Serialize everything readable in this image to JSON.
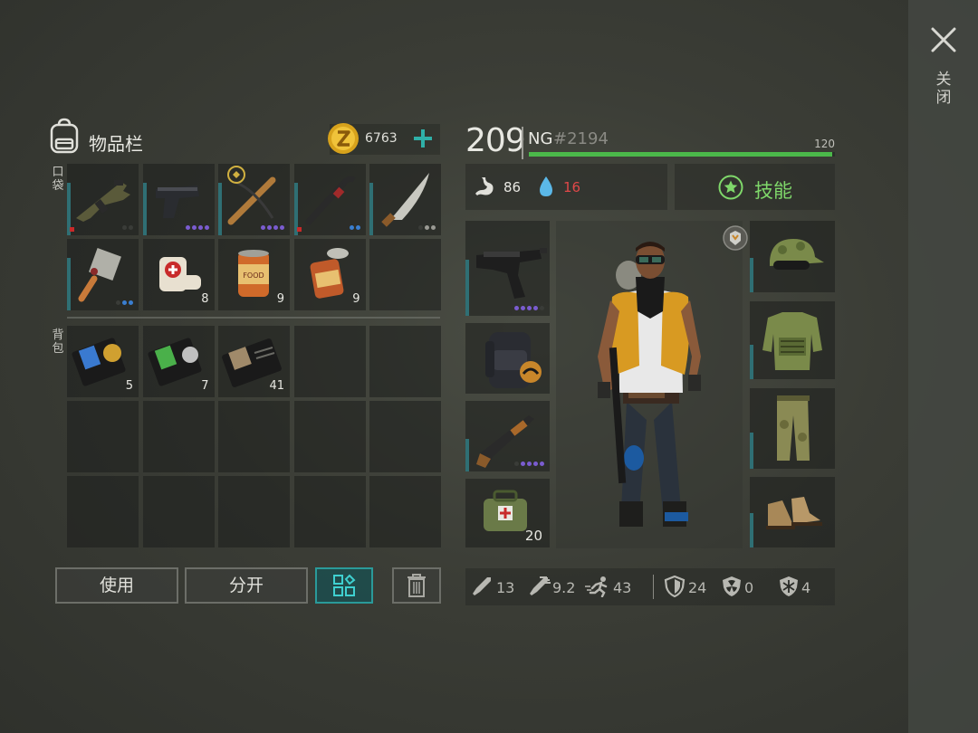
{
  "close": {
    "label": "关闭"
  },
  "inventory": {
    "title": "物品栏",
    "coins": "6763",
    "pocket_label": "口袋",
    "backpack_label": "背包",
    "pocket_slots": [
      {
        "item": "assault-rifle",
        "dots": [
          "dark",
          "dark"
        ],
        "red": true
      },
      {
        "item": "pistol",
        "dots": [
          "",
          "",
          "",
          ""
        ]
      },
      {
        "item": "crossbow",
        "dots": [
          "",
          "",
          "",
          ""
        ]
      },
      {
        "item": "crowbar",
        "dots": [
          "blue",
          "blue"
        ],
        "red": true
      },
      {
        "item": "machete",
        "dots": [
          "dark",
          "gray",
          "gray"
        ]
      },
      {
        "item": "cleaver",
        "dots": [
          "dark",
          "blue",
          "blue"
        ]
      },
      {
        "item": "bandage",
        "qty": "8"
      },
      {
        "item": "canned-food",
        "qty": "9"
      },
      {
        "item": "open-can",
        "qty": "9"
      },
      {
        "item": "empty"
      }
    ],
    "backpack_slots": [
      {
        "item": "gold-badge-id",
        "qty": "5"
      },
      {
        "item": "silver-badge-id",
        "qty": "7"
      },
      {
        "item": "document-id",
        "qty": "41"
      }
    ],
    "buttons": {
      "use": "使用",
      "split": "分开"
    }
  },
  "character": {
    "level": "209",
    "prefix": "NG",
    "player_id": "#2194",
    "xp_max": "120",
    "xp_progress": 0.99,
    "hunger": "86",
    "thirst": "16",
    "skills_label": "技能",
    "equipment": {
      "weapon": {
        "item": "uzi"
      },
      "backpack": {
        "item": "tactical-backpack"
      },
      "secondary": {
        "item": "shotgun"
      },
      "medkit": {
        "item": "medkit",
        "qty": "20"
      },
      "head": {
        "item": "camo-cap-goggles"
      },
      "body": {
        "item": "tactical-vest"
      },
      "legs": {
        "item": "camo-pants"
      },
      "feet": {
        "item": "boots"
      }
    },
    "combat_stats": {
      "melee": "13",
      "ranged": "9.2",
      "speed": "43",
      "armor": "24",
      "radiation": "0",
      "cold": "4"
    }
  },
  "colors": {
    "accent_teal": "#2a9a9a",
    "xp_green": "#4bb84a",
    "skills_green": "#7fd86a",
    "thirst_red": "#e04848"
  }
}
